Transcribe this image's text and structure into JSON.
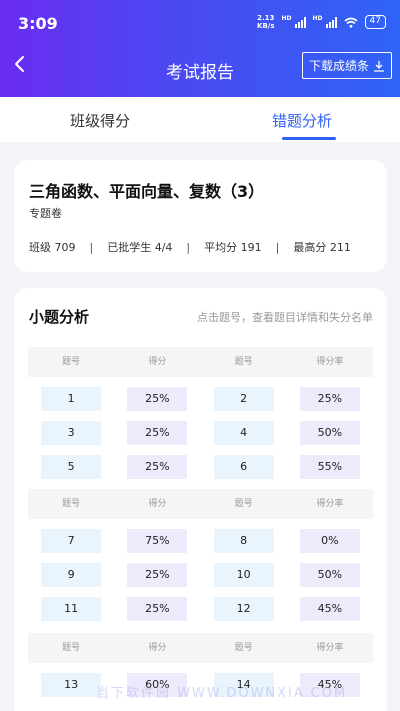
{
  "status": {
    "time": "3:09",
    "speed_top": "2.13",
    "speed_bottom": "KB/s",
    "hd1": "HD",
    "hd2": "HD",
    "battery": "47"
  },
  "nav": {
    "title": "考试报告",
    "download_label": "下载成绩条"
  },
  "tabs": [
    {
      "label": "班级得分"
    },
    {
      "label": "错题分析"
    }
  ],
  "exam": {
    "title": "三角函数、平面向量、复数（3）",
    "subtitle": "专题卷",
    "stats": [
      "班级 709",
      "已批学生 4/4",
      "平均分 191",
      "最高分 211"
    ]
  },
  "analysis": {
    "title": "小题分析",
    "hint": "点击题号，查看题目详情和失分名单",
    "headers": [
      "题号",
      "得分",
      "题号",
      "得分率"
    ],
    "rows": [
      [
        "1",
        "25%",
        "2",
        "25%"
      ],
      [
        "3",
        "25%",
        "4",
        "50%"
      ],
      [
        "5",
        "25%",
        "6",
        "55%"
      ],
      [
        "7",
        "75%",
        "8",
        "0%"
      ],
      [
        "9",
        "25%",
        "10",
        "50%"
      ],
      [
        "11",
        "25%",
        "12",
        "45%"
      ],
      [
        "13",
        "60%",
        "14",
        "45%"
      ]
    ]
  },
  "watermark": "当下软件园 WWW.DOWNXIA.COM"
}
